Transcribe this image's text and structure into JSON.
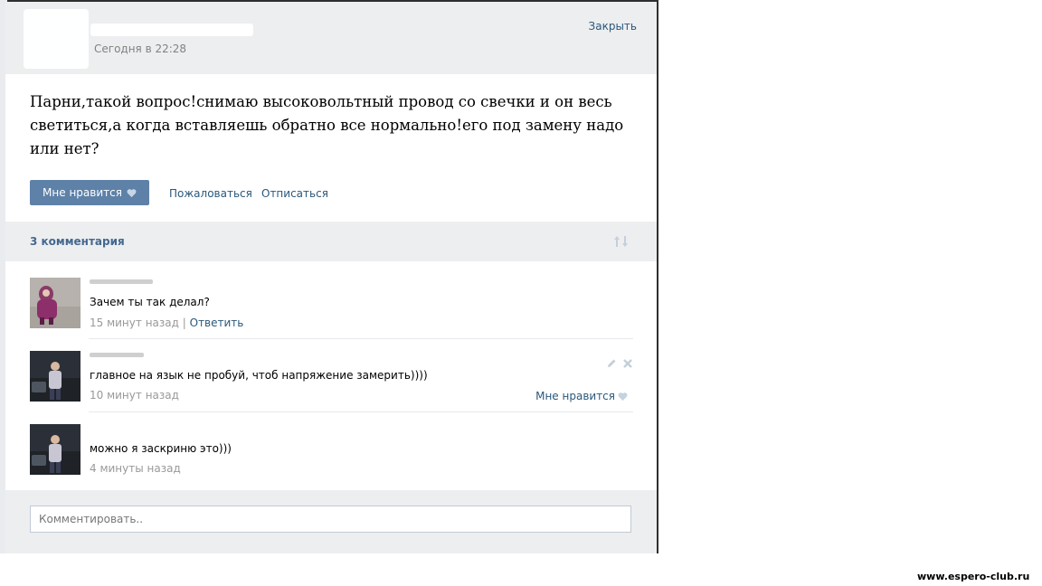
{
  "popup": {
    "close_label": "Закрыть",
    "post": {
      "time": "Сегодня в 22:28",
      "text": "Парни,такой вопрос!снимаю высоковольтный провод со свечки и он весь светиться,а когда вставляешь обратно все нормально!его под замену надо или нет?",
      "like_label": "Мне нравится",
      "report_label": "Пожаловаться",
      "unsubscribe_label": "Отписаться"
    },
    "comments_header": "3 комментария",
    "comments": [
      {
        "text": "Зачем ты так делал?",
        "time": "15 минут назад",
        "separator": "|",
        "reply_label": "Ответить"
      },
      {
        "text": "главное на язык не пробуй, чтоб напряжение замерить))))",
        "time": "10 минут назад",
        "like_label": "Мне нравится"
      },
      {
        "text": "можно я заскриню это)))",
        "time": "4 минуты назад"
      }
    ],
    "comment_input_placeholder": "Комментировать.."
  },
  "watermark": "www.espero-club.ru",
  "colors": {
    "accent": "#5e81a8",
    "link": "#2b587a",
    "header_bg": "#edeef0",
    "muted_text": "#999999"
  }
}
